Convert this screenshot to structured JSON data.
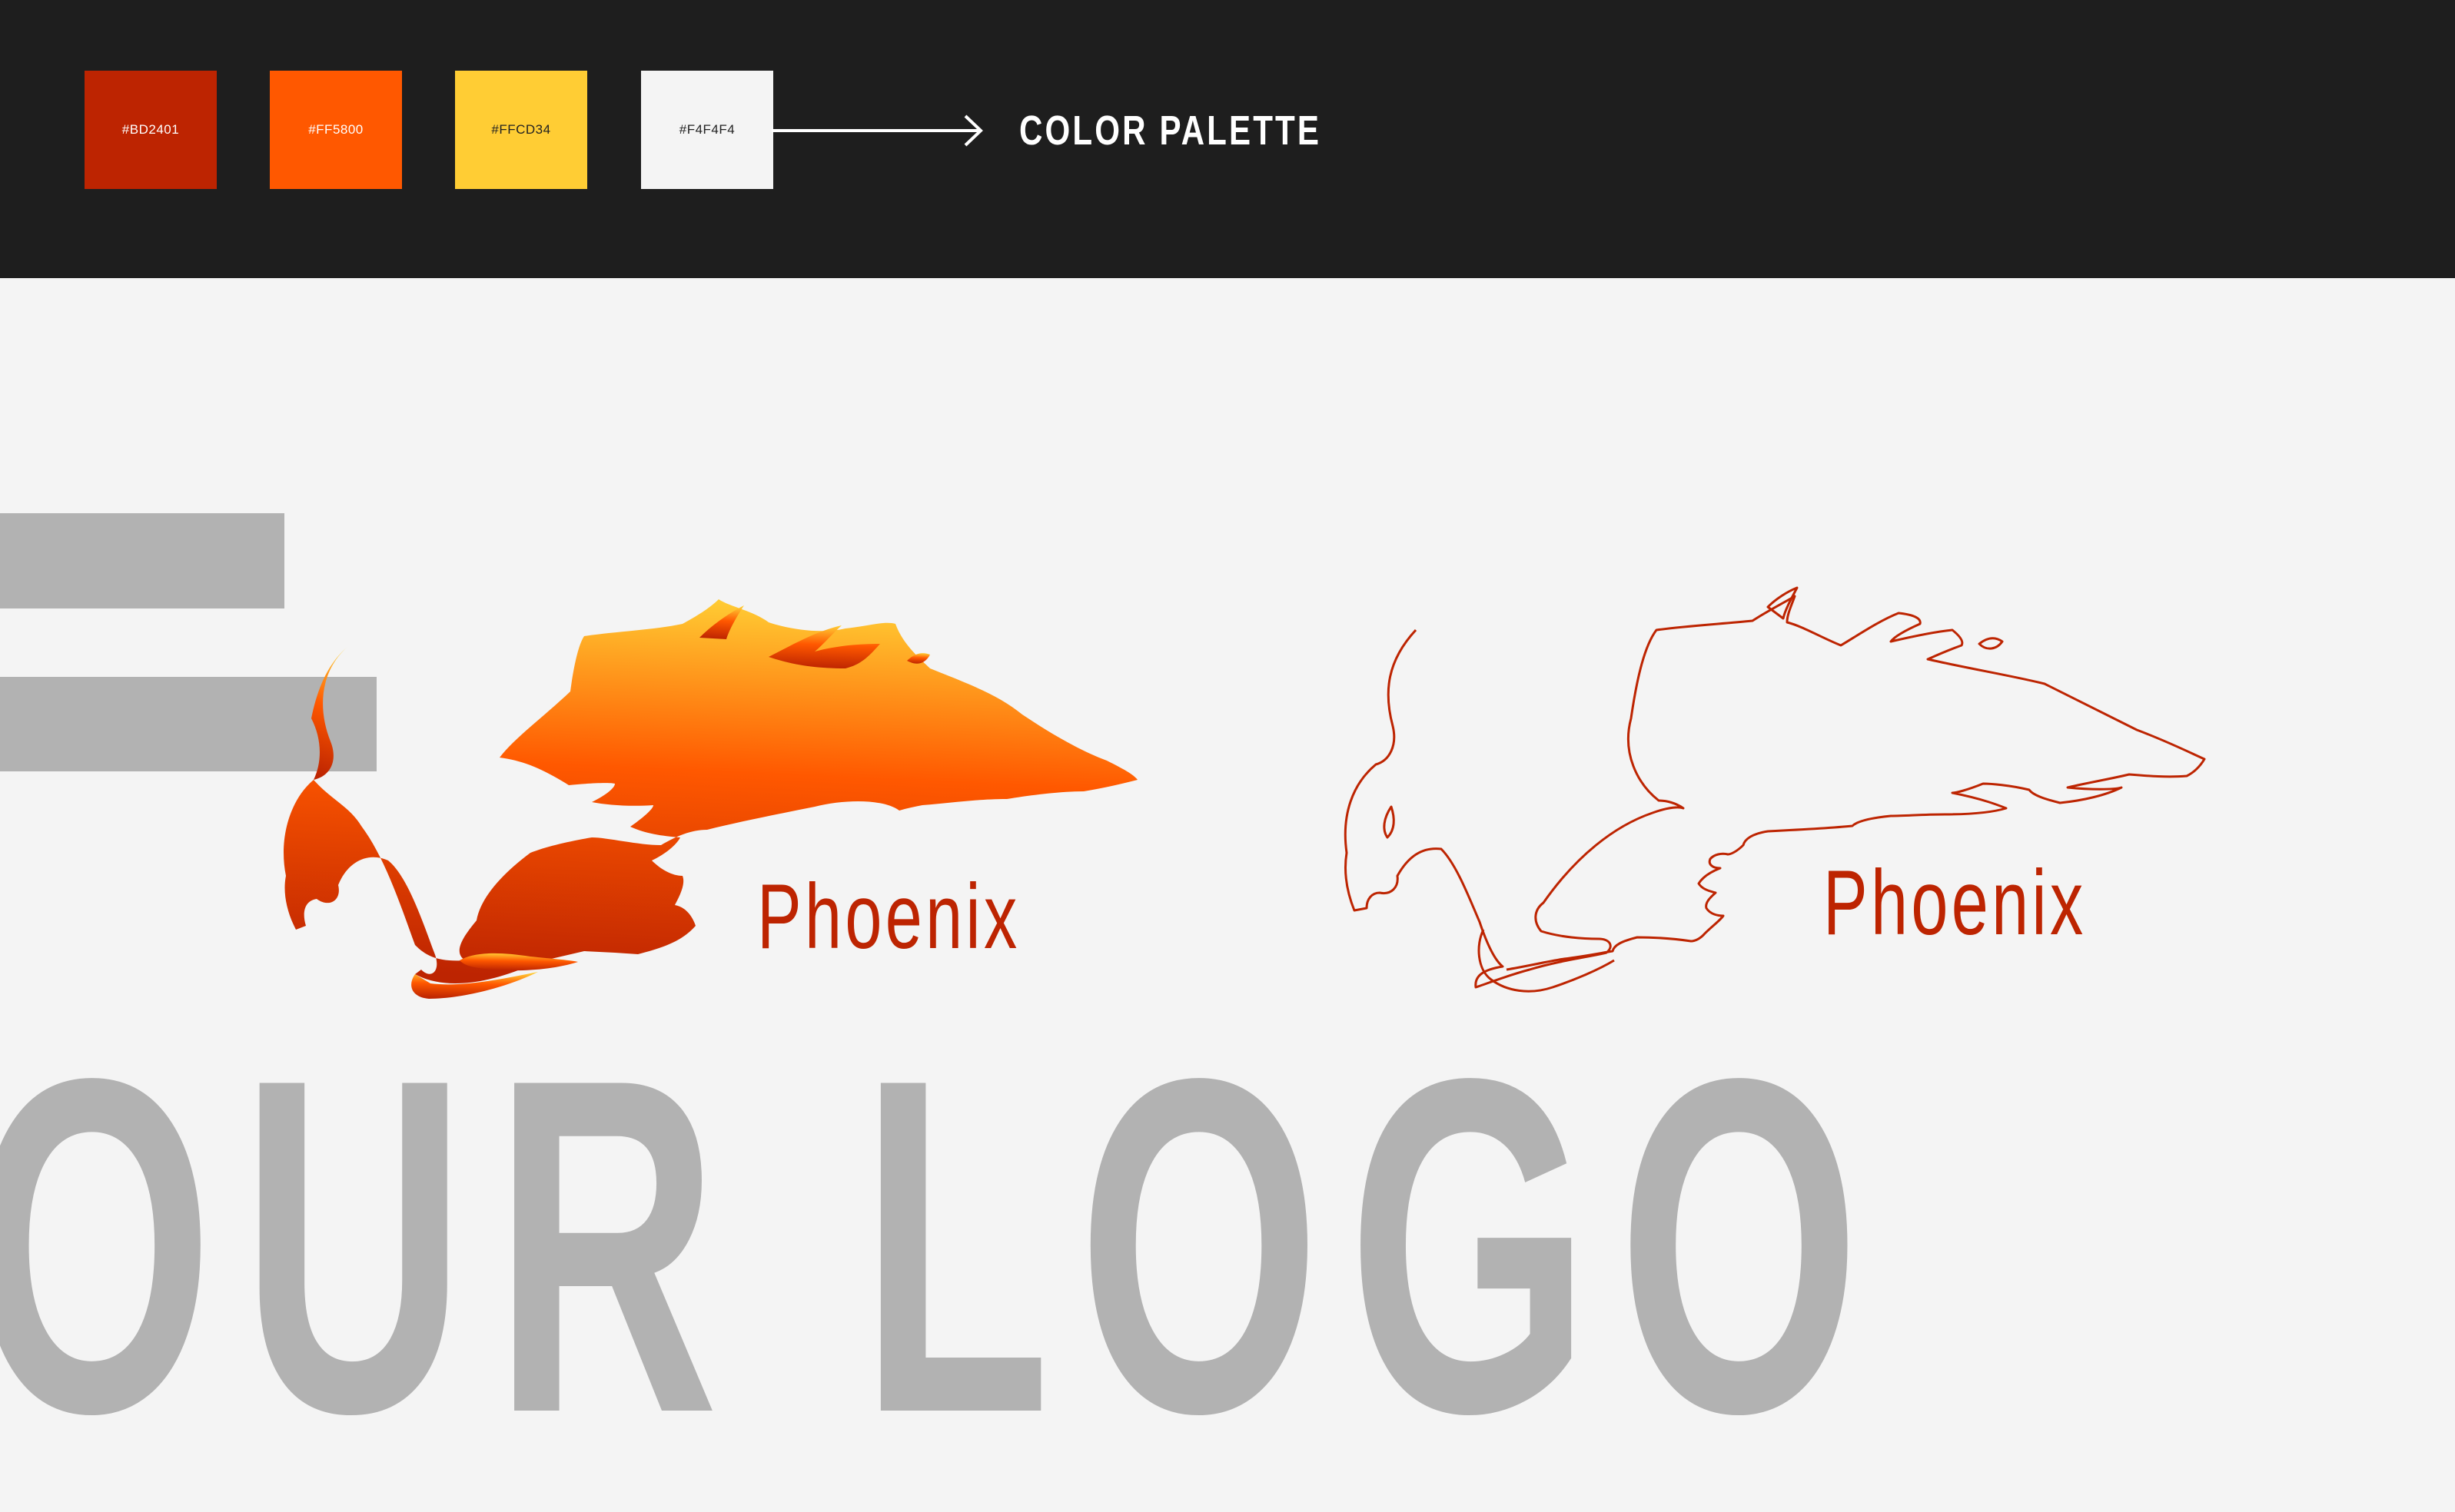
{
  "palette": {
    "title": "COLOR PALETTE",
    "swatches": [
      {
        "hex": "#BD2401",
        "label": "#BD2401"
      },
      {
        "hex": "#FF5800",
        "label": "#FF5800"
      },
      {
        "hex": "#FFCD34",
        "label": "#FFCD34"
      },
      {
        "hex": "#F4F4F4",
        "label": "#F4F4F4"
      }
    ]
  },
  "logo": {
    "wordmark_filled": "Phoenix",
    "wordmark_outline": "Phoenix",
    "gradient_colors": [
      "#FFCD34",
      "#FF5800",
      "#BD2401"
    ]
  },
  "section": {
    "title": "OUR LOGO"
  },
  "icons": {
    "arrow": "arrow-right-icon",
    "filled_logo": "phoenix-logo-filled",
    "outline_logo": "phoenix-logo-outline"
  },
  "colors": {
    "background": "#F4F4F4",
    "topbar": "#1E1E1E",
    "muted": "#B2B2B2",
    "accent": "#BD2401"
  }
}
